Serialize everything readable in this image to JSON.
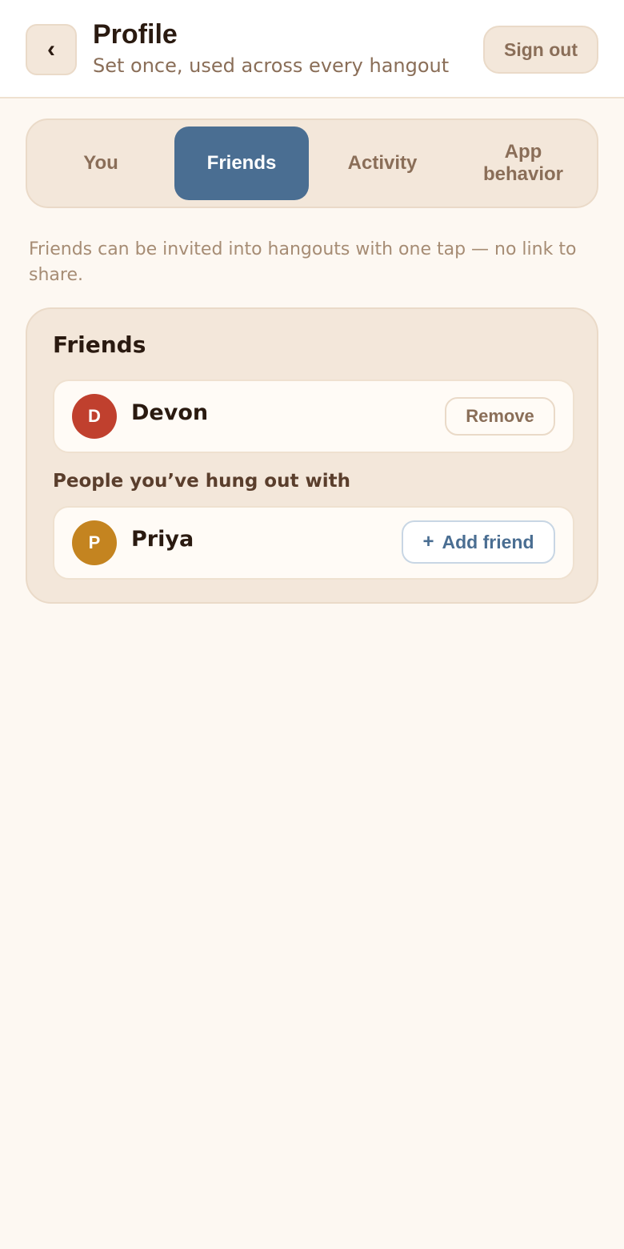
{
  "header": {
    "back_icon": "chevron-left-icon",
    "back_glyph": "‹",
    "title": "Profile",
    "subtitle": "Set once, used across every hangout",
    "signout_label": "Sign out"
  },
  "tabs": [
    {
      "label": "You",
      "active": false
    },
    {
      "label": "Friends",
      "active": true
    },
    {
      "label": "Activity",
      "active": false
    },
    {
      "label": "App behavior",
      "active": false
    }
  ],
  "hint": "Friends can be invited into hangouts with one tap — no link to share.",
  "friends_card": {
    "title": "Friends",
    "friends": [
      {
        "initial": "D",
        "name": "Devon",
        "avatar_color": "#c0402e",
        "action_label": "Remove"
      }
    ],
    "section_label": "People you’ve hung out with",
    "people": [
      {
        "initial": "P",
        "name": "Priya",
        "avatar_color": "#c48420",
        "action_icon": "plus-icon",
        "action_glyph": "+",
        "action_label": "Add friend"
      }
    ]
  },
  "colors": {
    "accent": "#4a6e92",
    "background": "#fdf8f2",
    "card": "#f3e7da",
    "muted_text": "#8a6e58"
  }
}
